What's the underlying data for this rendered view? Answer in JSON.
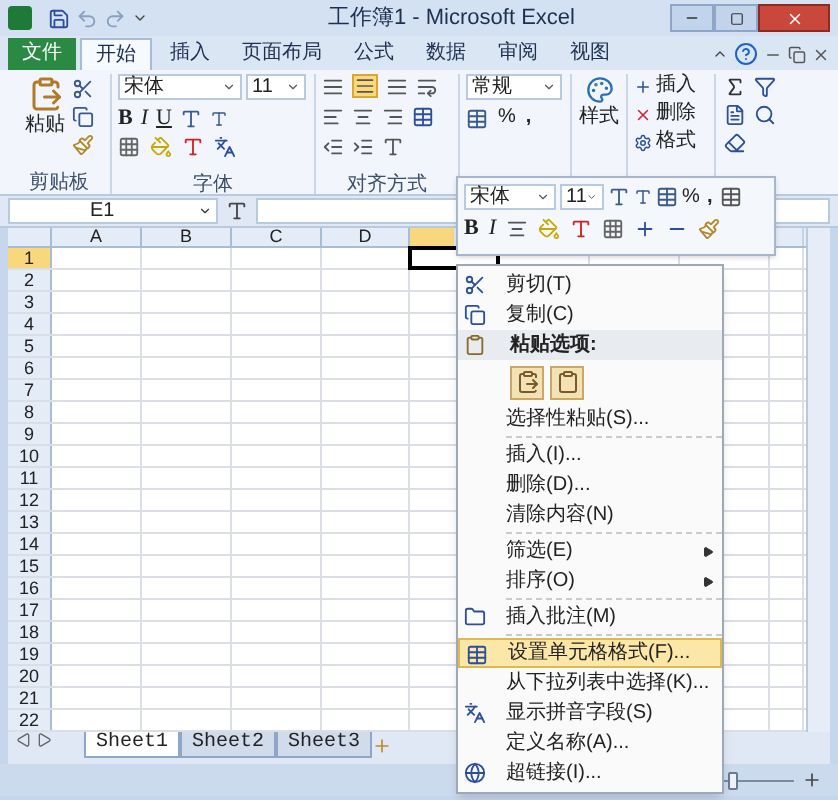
{
  "title_bar": {
    "title": "工作簿1 - Microsoft Excel"
  },
  "ribbon_tabs": [
    {
      "label": "文件",
      "kind": "file",
      "selected": false
    },
    {
      "label": "开始",
      "kind": "tab",
      "selected": true
    },
    {
      "label": "插入",
      "kind": "tab",
      "selected": false
    },
    {
      "label": "页面布局",
      "kind": "tab",
      "selected": false
    },
    {
      "label": "公式",
      "kind": "tab",
      "selected": false
    },
    {
      "label": "数据",
      "kind": "tab",
      "selected": false
    },
    {
      "label": "审阅",
      "kind": "tab",
      "selected": false
    },
    {
      "label": "视图",
      "kind": "tab",
      "selected": false
    }
  ],
  "clipboard_group": {
    "paste": "粘贴",
    "label": "剪贴板"
  },
  "font_group": {
    "font": "宋体",
    "size": "11",
    "bold": "B",
    "italic": "I",
    "underline": "U",
    "label": "字体"
  },
  "alignment_group": {
    "label": "对齐方式"
  },
  "number_group": {
    "format": "常规",
    "percent": "%",
    "comma": ","
  },
  "styles_group": {
    "label": "样式"
  },
  "cells_group": {
    "items": [
      "插入",
      "删除",
      "格式"
    ]
  },
  "formula_bar": {
    "name_box": "E1"
  },
  "columns": [
    {
      "label": "A",
      "selected": false
    },
    {
      "label": "B",
      "selected": false
    },
    {
      "label": "C",
      "selected": false
    },
    {
      "label": "D",
      "selected": false
    },
    {
      "selected": true
    }
  ],
  "rows": [
    {
      "label": "1",
      "selected": true
    },
    {
      "label": "2",
      "selected": false
    },
    {
      "label": "3",
      "selected": false
    },
    {
      "label": "4",
      "selected": false
    },
    {
      "label": "5",
      "selected": false
    },
    {
      "label": "6",
      "selected": false
    },
    {
      "label": "7",
      "selected": false
    },
    {
      "label": "8",
      "selected": false
    },
    {
      "label": "9",
      "selected": false
    },
    {
      "label": "10",
      "selected": false
    },
    {
      "label": "11",
      "selected": false
    },
    {
      "label": "12",
      "selected": false
    },
    {
      "label": "13",
      "selected": false
    },
    {
      "label": "14",
      "selected": false
    },
    {
      "label": "15",
      "selected": false
    },
    {
      "label": "16",
      "selected": false
    },
    {
      "label": "17",
      "selected": false
    },
    {
      "label": "18",
      "selected": false
    },
    {
      "label": "19",
      "selected": false
    },
    {
      "label": "20",
      "selected": false
    },
    {
      "label": "21",
      "selected": false
    },
    {
      "label": "22",
      "selected": false
    }
  ],
  "mini_toolbar": {
    "font": "宋体",
    "size": "11",
    "percent": "%",
    "comma": ",",
    "bold": "B",
    "italic": "I"
  },
  "context_menu": {
    "items": [
      {
        "kind": "item",
        "label": "剪切(T)",
        "selected": false,
        "submenu": false
      },
      {
        "kind": "item",
        "label": "复制(C)",
        "selected": false,
        "submenu": false
      },
      {
        "kind": "header",
        "label": "粘贴选项:"
      },
      {
        "kind": "paste_options"
      },
      {
        "kind": "item",
        "label": "选择性粘贴(S)...",
        "selected": false,
        "submenu": false
      },
      {
        "kind": "separator"
      },
      {
        "kind": "item",
        "label": "插入(I)...",
        "selected": false,
        "submenu": false
      },
      {
        "kind": "item",
        "label": "删除(D)...",
        "selected": false,
        "submenu": false
      },
      {
        "kind": "item",
        "label": "清除内容(N)",
        "selected": false,
        "submenu": false
      },
      {
        "kind": "separator"
      },
      {
        "kind": "item",
        "label": "筛选(E)",
        "selected": false,
        "submenu": true
      },
      {
        "kind": "item",
        "label": "排序(O)",
        "selected": false,
        "submenu": true
      },
      {
        "kind": "separator"
      },
      {
        "kind": "item",
        "label": "插入批注(M)",
        "selected": false,
        "submenu": false
      },
      {
        "kind": "separator"
      },
      {
        "kind": "item",
        "label": "设置单元格格式(F)...",
        "selected": true,
        "submenu": false
      },
      {
        "kind": "item",
        "label": "从下拉列表中选择(K)...",
        "selected": false,
        "submenu": false
      },
      {
        "kind": "item",
        "label": "显示拼音字段(S)",
        "selected": false,
        "submenu": false
      },
      {
        "kind": "item",
        "label": "定义名称(A)...",
        "selected": false,
        "submenu": false
      },
      {
        "kind": "item",
        "label": "超链接(I)...",
        "selected": false,
        "submenu": false
      }
    ]
  },
  "sheet_tabs": [
    {
      "label": "Sheet1",
      "selected": true
    },
    {
      "label": "Sheet2",
      "selected": false
    },
    {
      "label": "Sheet3",
      "selected": false
    }
  ],
  "zoom": {
    "level": 0.5
  }
}
